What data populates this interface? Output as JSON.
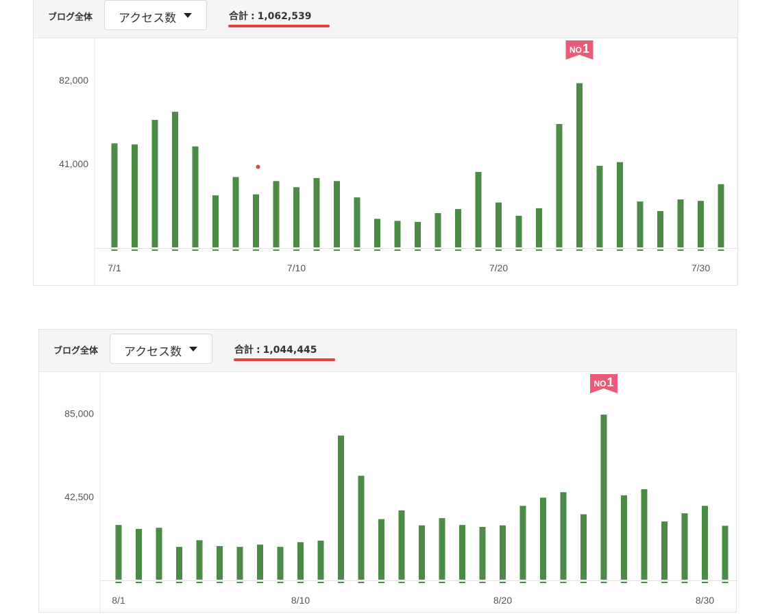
{
  "colors": {
    "bar": "#4b8b45",
    "rank_badge": "#ea5b7a",
    "total_underline": "#e0463d"
  },
  "chart_data": [
    {
      "type": "bar",
      "scope_label": "ブログ全体",
      "metric_select": {
        "value": "アクセス数",
        "icon": "caret-down-icon"
      },
      "total_label": "合計",
      "total_value": "1,062,539",
      "badge": {
        "text_prefix": "NO",
        "text_number": "1",
        "category": "7/24"
      },
      "categories": [
        "7/1",
        "7/2",
        "7/3",
        "7/4",
        "7/5",
        "7/6",
        "7/7",
        "7/8",
        "7/9",
        "7/10",
        "7/11",
        "7/12",
        "7/13",
        "7/14",
        "7/15",
        "7/16",
        "7/17",
        "7/18",
        "7/19",
        "7/20",
        "7/21",
        "7/22",
        "7/23",
        "7/24",
        "7/25",
        "7/26",
        "7/27",
        "7/28",
        "7/29",
        "7/30",
        "7/31"
      ],
      "values": [
        51000,
        50500,
        62500,
        66500,
        49500,
        25500,
        34500,
        26000,
        32500,
        29500,
        34000,
        32500,
        24500,
        14000,
        13000,
        12500,
        16800,
        18800,
        37000,
        22000,
        15500,
        19200,
        60500,
        80500,
        40000,
        41800,
        22500,
        17800,
        23500,
        22800,
        31000
      ],
      "x_tick_labels": [
        "7/1",
        "7/10",
        "7/20",
        "7/30"
      ],
      "y_tick_labels": [
        "41,000",
        "82,000"
      ],
      "y_ticks": [
        41000,
        82000
      ],
      "ylim": [
        0,
        102500
      ],
      "annotation": {
        "type": "red-dot",
        "category": "7/8",
        "value": 39500
      }
    },
    {
      "type": "bar",
      "scope_label": "ブログ全体",
      "metric_select": {
        "value": "アクセス数",
        "icon": "caret-down-icon"
      },
      "total_label": "合計",
      "total_value": "1,044,445",
      "badge": {
        "text_prefix": "NO",
        "text_number": "1",
        "category": "8/25"
      },
      "categories": [
        "8/1",
        "8/2",
        "8/3",
        "8/4",
        "8/5",
        "8/6",
        "8/7",
        "8/8",
        "8/9",
        "8/10",
        "8/11",
        "8/12",
        "8/13",
        "8/14",
        "8/15",
        "8/16",
        "8/17",
        "8/18",
        "8/19",
        "8/20",
        "8/21",
        "8/22",
        "8/23",
        "8/24",
        "8/25",
        "8/26",
        "8/27",
        "8/28",
        "8/29",
        "8/30",
        "8/31"
      ],
      "values": [
        28000,
        26000,
        26600,
        16800,
        20200,
        17200,
        16800,
        18000,
        16800,
        19200,
        20000,
        73800,
        53200,
        31000,
        35500,
        27800,
        31500,
        28000,
        27000,
        27800,
        37800,
        42000,
        44800,
        33500,
        84500,
        43200,
        46300,
        29800,
        34000,
        37800,
        27600
      ],
      "x_tick_labels": [
        "8/1",
        "8/10",
        "8/20",
        "8/30"
      ],
      "y_tick_labels": [
        "42,500",
        "85,000"
      ],
      "y_ticks": [
        42500,
        85000
      ],
      "ylim": [
        0,
        106300
      ]
    }
  ]
}
